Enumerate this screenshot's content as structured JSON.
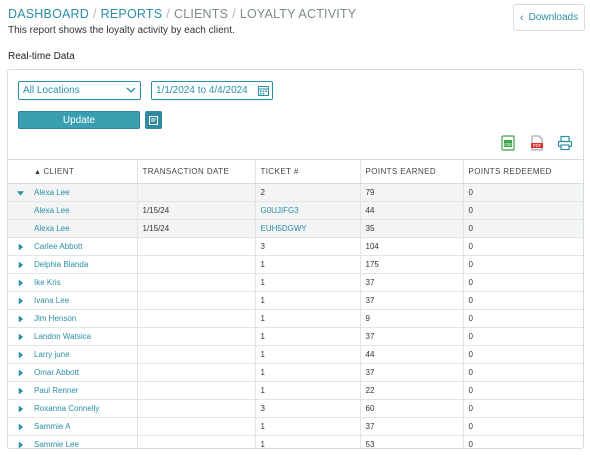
{
  "breadcrumb": {
    "items": [
      {
        "label": "DASHBOARD",
        "link": true
      },
      {
        "label": "REPORTS",
        "link": true
      },
      {
        "label": "CLIENTS",
        "link": false
      },
      {
        "label": "LOYALTY ACTIVITY",
        "link": false
      }
    ],
    "separator": "/"
  },
  "description": "This report shows the loyalty activity by each client.",
  "downloads_label": "Downloads",
  "section_title": "Real-time Data",
  "filters": {
    "location_value": "All Locations",
    "date_range_value": "1/1/2024 to 4/4/2024"
  },
  "update_label": "Update",
  "export_icons": [
    "excel-csv-icon",
    "pdf-icon",
    "print-icon"
  ],
  "colors": {
    "accent": "#2b8fa6",
    "button": "#3a9fb0",
    "row_highlight": "#f3f5f5"
  },
  "table": {
    "columns": [
      "CLIENT",
      "TRANSACTION DATE",
      "TICKET #",
      "POINTS EARNED",
      "POINTS REDEEMED"
    ],
    "sorted_column": "CLIENT",
    "rows": [
      {
        "client": "Alexa Lee",
        "date": "",
        "ticket": "2",
        "earned": "79",
        "redeemed": "0",
        "expanded": true,
        "children": [
          {
            "client": "Alexa Lee",
            "date": "1/15/24",
            "ticket": "G0UJIFG3",
            "earned": "44",
            "redeemed": "0"
          },
          {
            "client": "Alexa Lee",
            "date": "1/15/24",
            "ticket": "EUH5DGWY",
            "earned": "35",
            "redeemed": "0"
          }
        ]
      },
      {
        "client": "Carlee Abbott",
        "date": "",
        "ticket": "3",
        "earned": "104",
        "redeemed": "0"
      },
      {
        "client": "Delphia Blanda",
        "date": "",
        "ticket": "1",
        "earned": "175",
        "redeemed": "0"
      },
      {
        "client": "Ike Kris",
        "date": "",
        "ticket": "1",
        "earned": "37",
        "redeemed": "0"
      },
      {
        "client": "Ivana Lee",
        "date": "",
        "ticket": "1",
        "earned": "37",
        "redeemed": "0"
      },
      {
        "client": "Jim Henson",
        "date": "",
        "ticket": "1",
        "earned": "9",
        "redeemed": "0"
      },
      {
        "client": "Landon Watsica",
        "date": "",
        "ticket": "1",
        "earned": "37",
        "redeemed": "0"
      },
      {
        "client": "Larry june",
        "date": "",
        "ticket": "1",
        "earned": "44",
        "redeemed": "0"
      },
      {
        "client": "Omar Abbott",
        "date": "",
        "ticket": "1",
        "earned": "37",
        "redeemed": "0"
      },
      {
        "client": "Paul Renner",
        "date": "",
        "ticket": "1",
        "earned": "22",
        "redeemed": "0"
      },
      {
        "client": "Roxanna Connelly",
        "date": "",
        "ticket": "3",
        "earned": "60",
        "redeemed": "0"
      },
      {
        "client": "Sammie A",
        "date": "",
        "ticket": "1",
        "earned": "37",
        "redeemed": "0"
      },
      {
        "client": "Sammie Lee",
        "date": "",
        "ticket": "1",
        "earned": "53",
        "redeemed": "0"
      }
    ]
  }
}
